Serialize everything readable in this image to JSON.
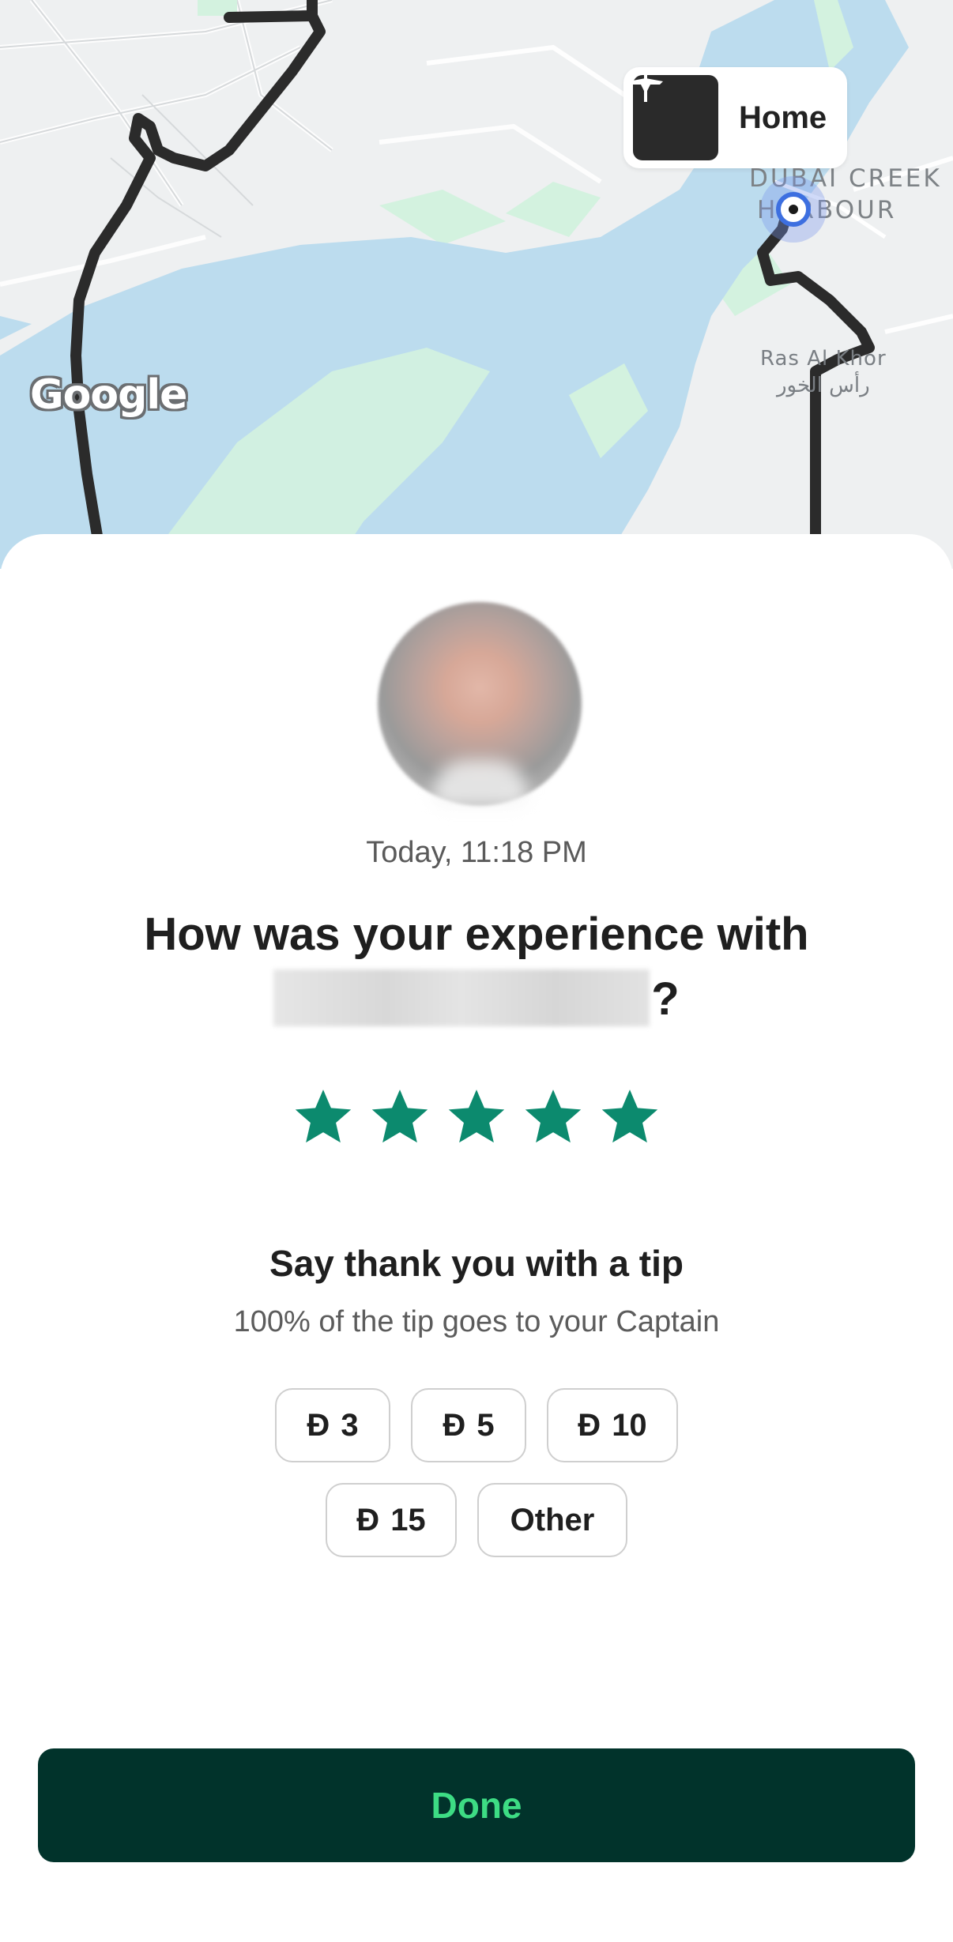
{
  "map": {
    "home_label": "Home",
    "area_label_line1": "DUBAI CREEK",
    "area_label_line2": "HARBOUR",
    "district_label_en": "Ras Al Khor",
    "district_label_ar": "رأس الخور",
    "provider": "Google"
  },
  "rating_sheet": {
    "timestamp": "Today, 11:18 PM",
    "question_prefix": "How was your experience with",
    "question_suffix": "?",
    "rating_value": 5,
    "rating_max": 5,
    "star_color": "#0c8a6e",
    "tip_title": "Say thank you with a tip",
    "tip_subtitle": "100% of the tip goes to your Captain",
    "currency_symbol": "Đ",
    "tips": [
      {
        "amount": "3"
      },
      {
        "amount": "5"
      },
      {
        "amount": "10"
      },
      {
        "amount": "15"
      }
    ],
    "other_label": "Other",
    "done_label": "Done"
  },
  "colors": {
    "done_bg": "#01332b",
    "done_text": "#3ddc84",
    "water": "#bcdcee",
    "park": "#d3f2df"
  }
}
